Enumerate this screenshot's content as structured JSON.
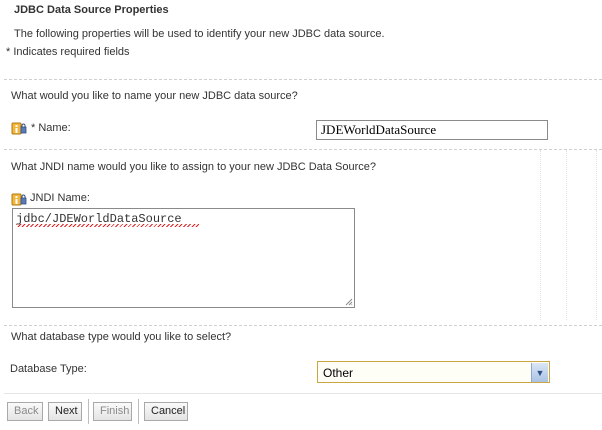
{
  "header": {
    "title": "JDBC Data Source Properties",
    "intro": "The following properties will be used to identify your new JDBC data source.",
    "required_note": "* Indicates required fields"
  },
  "name_section": {
    "question": "What would you like to name your new JDBC data source?",
    "label": "* Name:",
    "value": "JDEWorldDataSource"
  },
  "jndi_section": {
    "question": "What JNDI name would you like to assign to your new JDBC Data Source?",
    "label": "JNDI Name:",
    "value": "jdbc/JDEWorldDataSource"
  },
  "dbtype_section": {
    "question": "What database type would you like to select?",
    "label": "Database Type:",
    "selected": "Other"
  },
  "buttons": {
    "back": "Back",
    "next": "Next",
    "finish": "Finish",
    "cancel": "Cancel"
  },
  "icons": {
    "info": "info-lock-icon",
    "dropdown": "chevron-down-icon"
  }
}
